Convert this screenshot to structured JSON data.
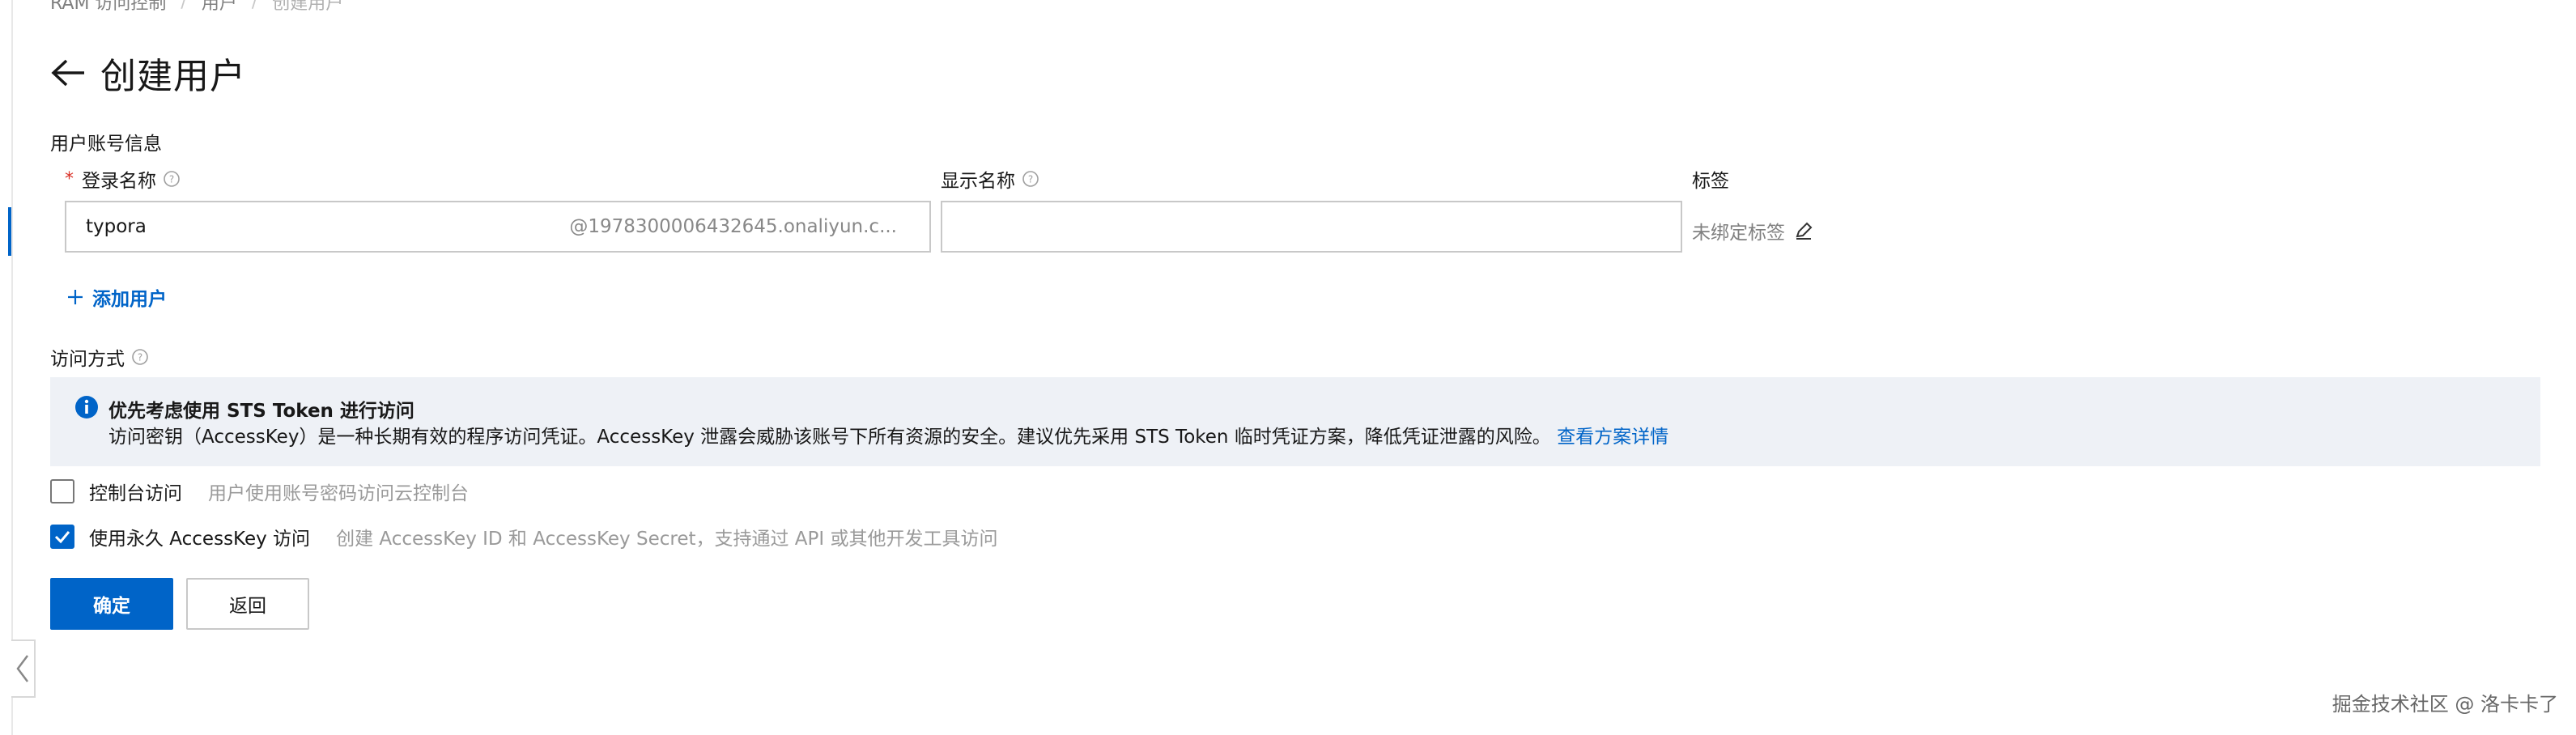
{
  "breadcrumb": [
    "RAM 访问控制",
    "用户",
    "创建用户"
  ],
  "page": {
    "title": "创建用户"
  },
  "account_section": {
    "label": "用户账号信息",
    "login_name_label": "登录名称",
    "login_name_value": "typora",
    "login_name_suffix": "@1978300006432645.onaliyun.c...",
    "display_name_label": "显示名称",
    "display_name_value": "",
    "tag_label": "标签",
    "tag_empty": "未绑定标签",
    "add_user": "添加用户"
  },
  "access_section": {
    "label": "访问方式",
    "alert_title": "优先考虑使用 STS Token 进行访问",
    "alert_body": "访问密钥（AccessKey）是一种长期有效的程序访问凭证。AccessKey 泄露会威胁该账号下所有资源的安全。建议优先采用 STS Token 临时凭证方案，降低凭证泄露的风险。",
    "alert_link": "查看方案详情",
    "console_label": "控制台访问",
    "console_desc": "用户使用账号密码访问云控制台",
    "console_checked": false,
    "ak_label": "使用永久 AccessKey 访问",
    "ak_desc": "创建 AccessKey ID 和 AccessKey Secret，支持通过 API 或其他开发工具访问",
    "ak_checked": true
  },
  "actions": {
    "confirm": "确定",
    "back": "返回"
  },
  "watermark": "掘金技术社区 @ 洛卡卡了",
  "colors": {
    "primary": "#0064c8",
    "required": "#d93026",
    "alert_bg": "#eef1f6"
  },
  "icons": [
    "back-arrow-icon",
    "help-icon",
    "edit-icon",
    "plus-icon",
    "info-icon",
    "check-icon",
    "chevron-left-icon"
  ]
}
